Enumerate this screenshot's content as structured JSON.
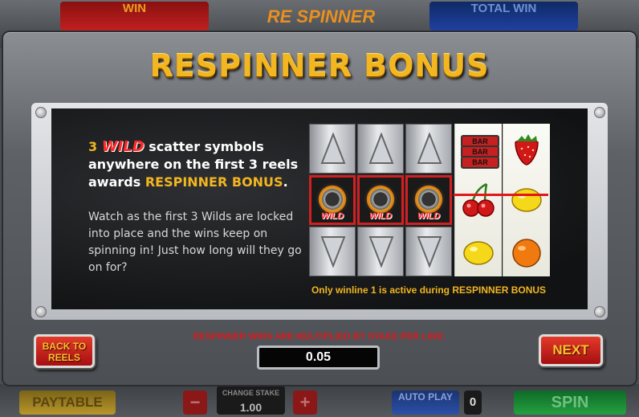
{
  "background": {
    "win_label": "WIN",
    "total_win_label": "TOTAL WIN",
    "logo_text": "RE SPINNER",
    "paytable_label": "PAYTABLE",
    "minus_label": "−",
    "plus_label": "+",
    "stake_caption": "CHANGE STAKE",
    "stake_value": "1.00",
    "autoplay_label": "AUTO PLAY",
    "autoplay_count": "0",
    "spin_label": "SPIN"
  },
  "dialog": {
    "title": "RESPINNER BONUS",
    "intro": {
      "num": "3",
      "wild": "WILD",
      "line1_rest": " scatter symbols",
      "line2": "anywhere on the first 3 reels",
      "line3_prefix": "awards ",
      "line3_bonus": "RESPINNER BONUS",
      "line3_suffix": "."
    },
    "description": "Watch as the first 3 Wilds are locked into place and the wins keep on spinning in! Just how long will they go on for?",
    "winline_note": "Only winline 1 is active during RESPINNER BONUS",
    "reels": {
      "wild_label": "WILD",
      "bar_label": "BAR"
    },
    "multiplier_note": "RESPINNER WINS ARE MULTIPLIED BY STAKE PER LINE:",
    "stake_per_line": "0.05",
    "back_button": "BACK TO REELS",
    "next_button": "NEXT"
  },
  "colors": {
    "gold": "#f2b620",
    "red": "#e01818"
  }
}
